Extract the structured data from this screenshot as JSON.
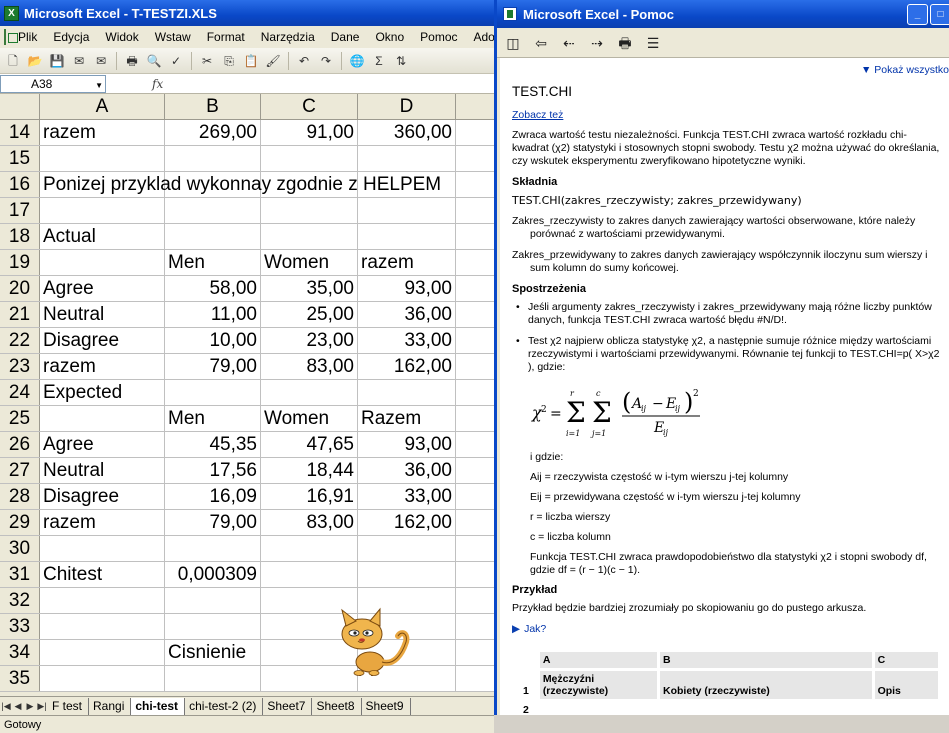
{
  "excel": {
    "title": "Microsoft Excel - T-TESTZI.XLS",
    "menu": [
      "Plik",
      "Edycja",
      "Widok",
      "Wstaw",
      "Format",
      "Narzędzia",
      "Dane",
      "Okno",
      "Pomoc",
      "Adobe PDF"
    ],
    "name_box": "A38",
    "fx": "fx",
    "columns": [
      "A",
      "B",
      "C",
      "D"
    ],
    "rows": [
      {
        "n": "14",
        "a": "razem",
        "b": "269,00",
        "c": "91,00",
        "d": "360,00"
      },
      {
        "n": "15",
        "a": "",
        "b": "",
        "c": "",
        "d": ""
      },
      {
        "n": "16",
        "a": "Ponizej przyklad wykonnay zgodnie z HELPEM",
        "b": "",
        "c": "",
        "d": ""
      },
      {
        "n": "17",
        "a": "",
        "b": "",
        "c": "",
        "d": ""
      },
      {
        "n": "18",
        "a": "Actual",
        "b": "",
        "c": "",
        "d": ""
      },
      {
        "n": "19",
        "a": "",
        "b": "Men",
        "c": "Women",
        "d": "razem"
      },
      {
        "n": "20",
        "a": "Agree",
        "b": "58,00",
        "c": "35,00",
        "d": "93,00"
      },
      {
        "n": "21",
        "a": "Neutral",
        "b": "11,00",
        "c": "25,00",
        "d": "36,00"
      },
      {
        "n": "22",
        "a": "Disagree",
        "b": "10,00",
        "c": "23,00",
        "d": "33,00"
      },
      {
        "n": "23",
        "a": "razem",
        "b": "79,00",
        "c": "83,00",
        "d": "162,00"
      },
      {
        "n": "24",
        "a": "Expected",
        "b": "",
        "c": "",
        "d": ""
      },
      {
        "n": "25",
        "a": "",
        "b": "Men",
        "c": "Women",
        "d": "Razem"
      },
      {
        "n": "26",
        "a": "Agree",
        "b": "45,35",
        "c": "47,65",
        "d": "93,00"
      },
      {
        "n": "27",
        "a": "Neutral",
        "b": "17,56",
        "c": "18,44",
        "d": "36,00"
      },
      {
        "n": "28",
        "a": "Disagree",
        "b": "16,09",
        "c": "16,91",
        "d": "33,00"
      },
      {
        "n": "29",
        "a": "razem",
        "b": "79,00",
        "c": "83,00",
        "d": "162,00"
      },
      {
        "n": "30",
        "a": "",
        "b": "",
        "c": "",
        "d": ""
      },
      {
        "n": "31",
        "a": "Chitest",
        "b": "0,000309",
        "c": "",
        "d": ""
      },
      {
        "n": "32",
        "a": "",
        "b": "",
        "c": "",
        "d": ""
      },
      {
        "n": "33",
        "a": "",
        "b": "",
        "c": "",
        "d": ""
      },
      {
        "n": "34",
        "a": "",
        "b": "Cisnienie",
        "c": "",
        "d": ""
      },
      {
        "n": "35",
        "a": "",
        "b": "",
        "c": "",
        "d": ""
      }
    ],
    "sheet_tabs": [
      "F test",
      "Rangi",
      "chi-test",
      "chi-test-2 (2)",
      "Sheet7",
      "Sheet8",
      "Sheet9"
    ],
    "active_tab": "chi-test",
    "status": "Gotowy"
  },
  "help": {
    "title": "Microsoft Excel - Pomoc",
    "show_all": "Pokaż wszystko",
    "heading": "TEST.CHI",
    "see_also": "Zobacz też",
    "intro": "Zwraca wartość testu niezależności. Funkcja TEST.CHI zwraca wartość rozkładu chi-kwadrat (χ2) statystyki i stosownych stopni swobody. Testu χ2 można używać do określania, czy wskutek eksperymentu zweryfikowano hipotetyczne wyniki.",
    "syntax_heading": "Składnia",
    "syntax": "TEST.CHI(zakres_rzeczywisty; zakres_przewidywany)",
    "arg1": "Zakres_rzeczywisty   to zakres danych zawierający wartości obserwowane, które należy porównać z wartościami przewidywanymi.",
    "arg2": "Zakres_przewidywany   to zakres danych zawierający współczynnik iloczynu sum wierszy i sum kolumn do sumy końcowej.",
    "remarks_heading": "Spostrzeżenia",
    "remark1": "Jeśli argumenty zakres_rzeczywisty i zakres_przewidywany mają różne liczby punktów danych, funkcja TEST.CHI zwraca wartość błędu #N/D!.",
    "remark2": "Test χ2 najpierw oblicza statystykę χ2, a następnie sumuje różnice między wartościami rzeczywistymi i wartościami przewidywanymi. Równanie tej funkcji to TEST.CHI=p( X>χ2 ), gdzie:",
    "where": "i gdzie:",
    "def1": "Aij = rzeczywista częstość w i-tym wierszu j-tej kolumny",
    "def2": "Eij = przewidywana częstość w i-tym wierszu j-tej kolumny",
    "def3": "r = liczba wierszy",
    "def4": "c = liczba kolumn",
    "closing": "Funkcja TEST.CHI zwraca prawdopodobieństwo dla statystyki χ2 i stopni swobody df, gdzie df = (r − 1)(c − 1).",
    "example_heading": "Przykład",
    "example_text": "Przykład będzie bardziej zrozumiały po skopiowaniu go do pustego arkusza.",
    "how": "Jak?",
    "table": {
      "headers": [
        "A",
        "B",
        "C"
      ],
      "row1": {
        "n": "1",
        "a": "Mężczyźni (rzeczywiste)",
        "b": "Kobiety (rzeczywiste)",
        "c": "Opis"
      },
      "row2": {
        "n": "2"
      }
    }
  },
  "colors": {
    "titlebar": "#0a48c8",
    "link": "#0033aa",
    "window_bg": "#ece9d8"
  }
}
